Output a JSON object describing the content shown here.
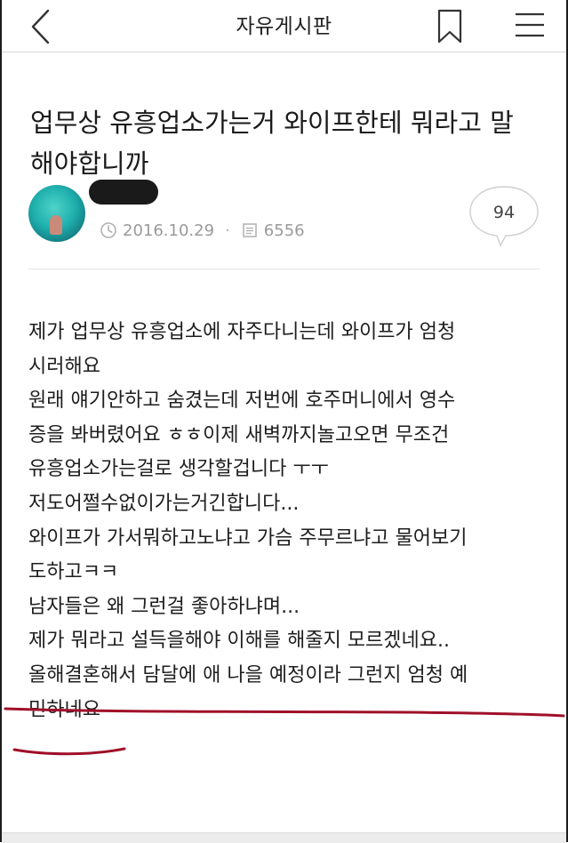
{
  "header": {
    "board_name": "자유게시판"
  },
  "post": {
    "title": "업무상 유흥업소가는거 와이프한테 뭐라고 말해야합니까",
    "date": "2016.10.29",
    "views": "6556",
    "comment_count": "94",
    "body_lines": [
      "제가 업무상 유흥업소에 자주다니는데 와이프가 엄청",
      "시러해요",
      "원래 얘기안하고 숨겼는데 저번에 호주머니에서 영수",
      "증을 봐버렸어요 ㅎㅎ이제 새벽까지놀고오면 무조건",
      "유흥업소가는걸로 생각할겁니다 ㅜㅜ",
      "저도어쩔수없이가는거긴합니다...",
      "와이프가 가서뭐하고노냐고 가슴 주무르냐고 물어보기",
      "도하고ㅋㅋ",
      "남자들은 왜 그런걸 좋아하냐며...",
      "제가 뭐라고 설득을해야 이해를 해줄지 모르겠네요..",
      "올해결혼해서 담달에 애 나을 예정이라 그런지 엄청 예",
      "민하네요"
    ]
  },
  "icons": {
    "back": "chevron-left-icon",
    "bookmark": "bookmark-icon",
    "menu": "hamburger-menu-icon",
    "clock": "clock-icon",
    "views": "document-icon",
    "comment": "speech-bubble-icon"
  },
  "colors": {
    "annotation": "#a0102a",
    "meta_text": "#9a9a9a",
    "redaction": "#1a1a1a"
  }
}
